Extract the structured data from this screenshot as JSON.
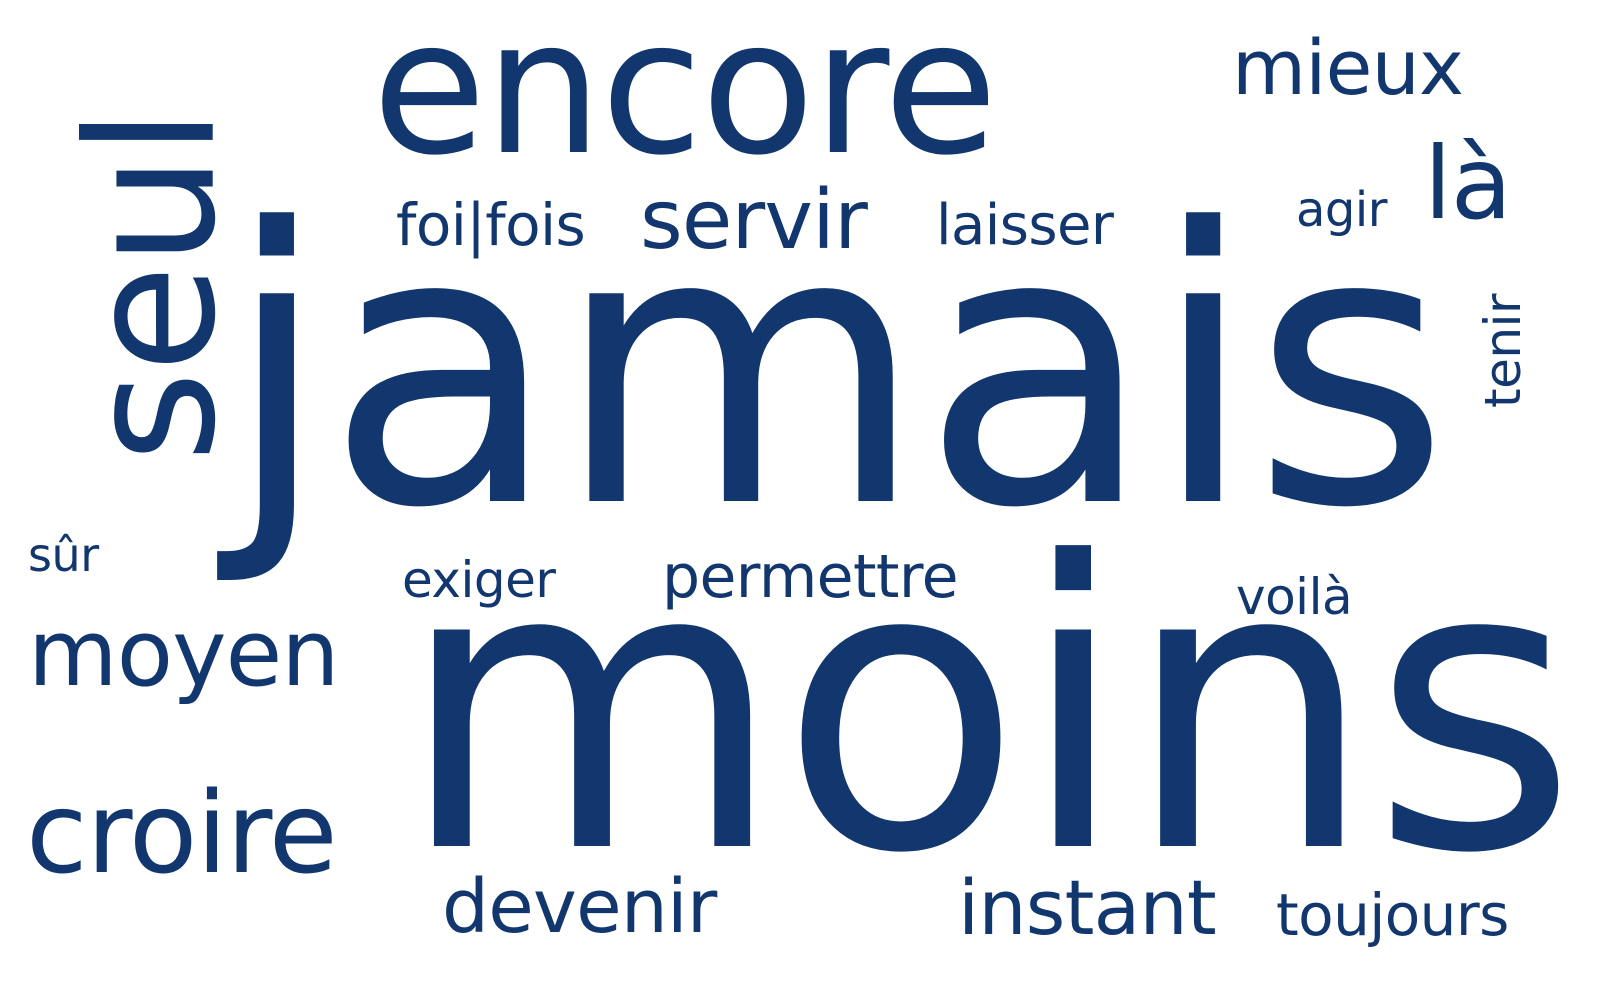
{
  "style": {
    "text_color": "#12366E",
    "background": "#FFFFFF"
  },
  "words": [
    {
      "id": "seul",
      "text": "seul"
    },
    {
      "id": "encore",
      "text": "encore"
    },
    {
      "id": "mieux",
      "text": "mieux"
    },
    {
      "id": "la",
      "text": "là"
    },
    {
      "id": "agir",
      "text": "agir"
    },
    {
      "id": "foi-fois",
      "text": "foi|fois"
    },
    {
      "id": "servir",
      "text": "servir"
    },
    {
      "id": "laisser",
      "text": "laisser"
    },
    {
      "id": "tenir",
      "text": "tenir"
    },
    {
      "id": "jamais",
      "text": "jamais"
    },
    {
      "id": "sur",
      "text": "sûr"
    },
    {
      "id": "exiger",
      "text": "exiger"
    },
    {
      "id": "permettre",
      "text": "permettre"
    },
    {
      "id": "voila",
      "text": "voilà"
    },
    {
      "id": "moyen",
      "text": "moyen"
    },
    {
      "id": "moins",
      "text": "moins"
    },
    {
      "id": "croire",
      "text": "croire"
    },
    {
      "id": "devenir",
      "text": "devenir"
    },
    {
      "id": "instant",
      "text": "instant"
    },
    {
      "id": "toujours",
      "text": "toujours"
    }
  ]
}
